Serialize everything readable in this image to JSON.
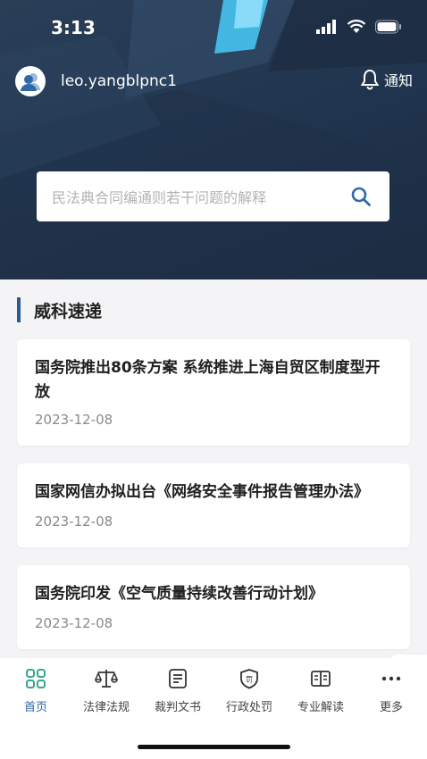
{
  "status_bar": {
    "time": "3:13"
  },
  "header": {
    "username": "leo.yangblpnc1",
    "notice_label": "通知"
  },
  "search": {
    "placeholder": "民法典合同编通则若干问题的解释"
  },
  "section": {
    "title": "威科速递"
  },
  "news": [
    {
      "title": "国务院推出80条方案 系统推进上海自贸区制度型开放",
      "date": "2023-12-08"
    },
    {
      "title": "国家网信办拟出台《网络安全事件报告管理办法》",
      "date": "2023-12-08"
    },
    {
      "title": "国务院印发《空气质量持续改善行动计划》",
      "date": "2023-12-08"
    }
  ],
  "tabs": [
    {
      "label": "首页",
      "icon": "home-grid-icon",
      "active": true
    },
    {
      "label": "法律法规",
      "icon": "scales-icon"
    },
    {
      "label": "裁判文书",
      "icon": "document-icon"
    },
    {
      "label": "行政处罚",
      "icon": "penalty-shield-icon"
    },
    {
      "label": "专业解读",
      "icon": "open-book-icon"
    },
    {
      "label": "更多",
      "icon": "more-dots-icon"
    }
  ],
  "colors": {
    "accent": "#2f6aa8",
    "hero": "#223650",
    "tab_active": "#2f6aa8"
  }
}
